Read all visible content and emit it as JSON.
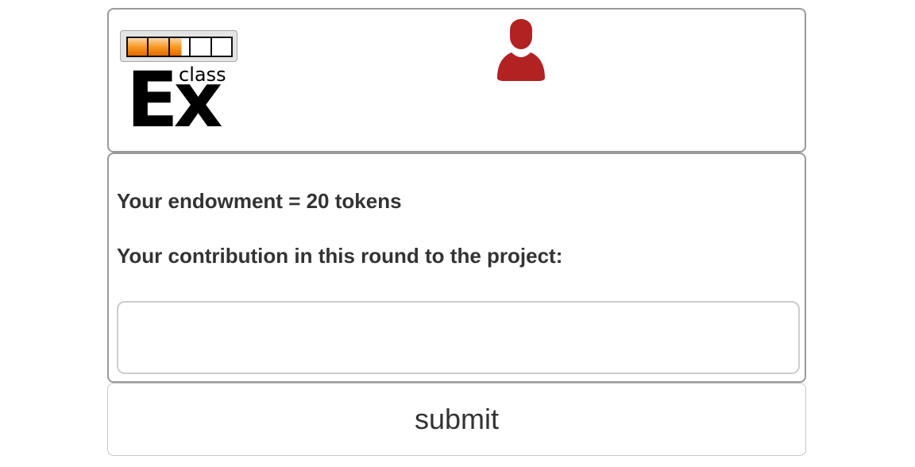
{
  "header": {
    "logo": {
      "text_main": "Ex",
      "text_small": "class",
      "progress_filled_segments": 2.6,
      "progress_total_segments": 5,
      "accent_color": "#f7941d"
    },
    "user_icon": {
      "name": "user-icon",
      "color": "#b22222"
    }
  },
  "main": {
    "endowment_text": "Your endowment = 20 tokens",
    "contribution_label": "Your contribution in this round to the project:",
    "contribution_input": {
      "value": "",
      "placeholder": ""
    }
  },
  "submit": {
    "label": "submit"
  }
}
